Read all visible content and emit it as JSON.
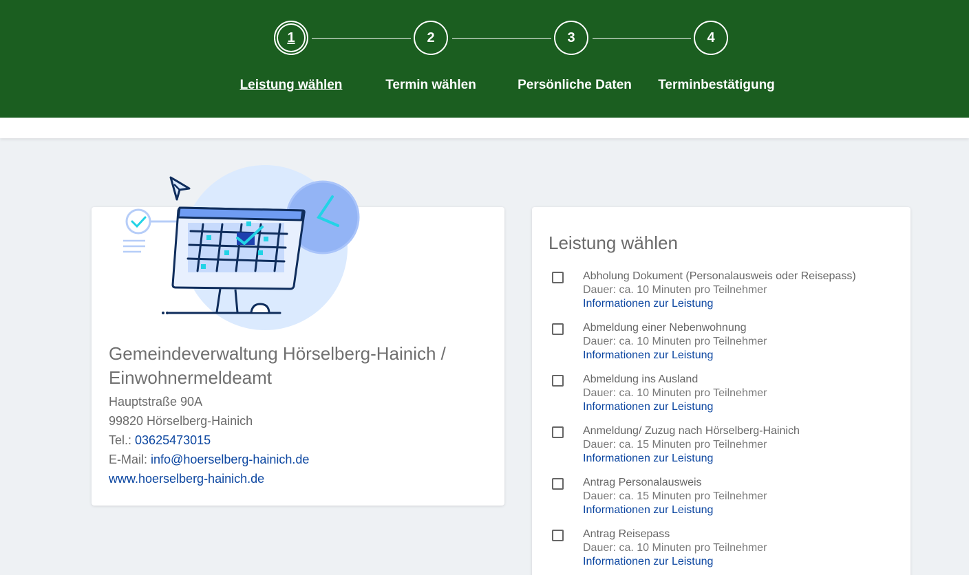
{
  "stepper": {
    "steps": [
      {
        "number": "1",
        "label": "Leistung wählen"
      },
      {
        "number": "2",
        "label": "Termin wählen"
      },
      {
        "number": "3",
        "label": "Persönliche Daten"
      },
      {
        "number": "4",
        "label": "Terminbestätigung"
      }
    ]
  },
  "office": {
    "name": "Gemeindeverwaltung Hörselberg-Hainich / Einwohnermeldeamt",
    "street": "Hauptstraße 90A",
    "city": "99820 Hörselberg-Hainich",
    "tel_label": "Tel.:",
    "tel": "03625473015",
    "email_label": "E-Mail:",
    "email": "info@hoerselberg-hainich.de",
    "website": "www.hoerselberg-hainich.de"
  },
  "services": {
    "title": "Leistung wählen",
    "items": [
      {
        "name": "Abholung Dokument (Personalausweis oder Reisepass)",
        "duration": "Dauer: ca. 10 Minuten pro Teilnehmer",
        "info": "Informationen zur Leistung"
      },
      {
        "name": "Abmeldung einer Nebenwohnung",
        "duration": "Dauer: ca. 10 Minuten pro Teilnehmer",
        "info": "Informationen zur Leistung"
      },
      {
        "name": "Abmeldung ins Ausland",
        "duration": "Dauer: ca. 10 Minuten pro Teilnehmer",
        "info": "Informationen zur Leistung"
      },
      {
        "name": "Anmeldung/ Zuzug nach Hörselberg-Hainich",
        "duration": "Dauer: ca. 15 Minuten pro Teilnehmer",
        "info": "Informationen zur Leistung"
      },
      {
        "name": "Antrag Personalausweis",
        "duration": "Dauer: ca. 15 Minuten pro Teilnehmer",
        "info": "Informationen zur Leistung"
      },
      {
        "name": "Antrag Reisepass",
        "duration": "Dauer: ca. 10 Minuten pro Teilnehmer",
        "info": "Informationen zur Leistung"
      }
    ]
  },
  "colors": {
    "header_green": "#1b5e20",
    "link_blue": "#0d47a1",
    "background": "#eef1f4"
  }
}
